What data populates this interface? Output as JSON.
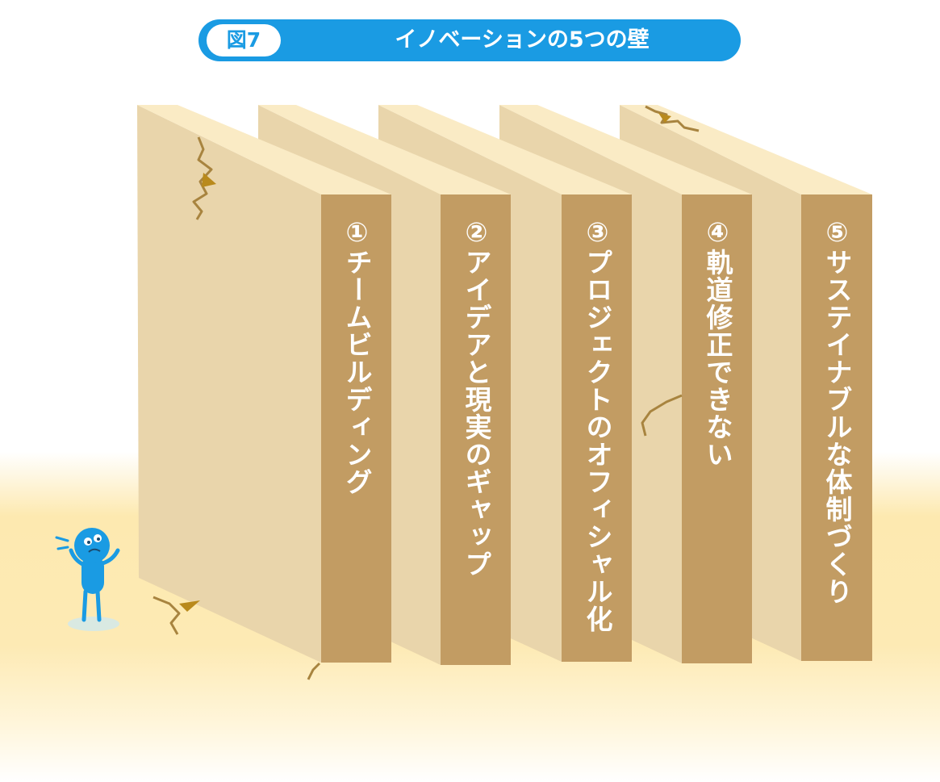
{
  "title": {
    "badge": "図7",
    "text": "イノベーションの5つの壁"
  },
  "walls": [
    {
      "label": "①チームビルディング"
    },
    {
      "label": "②アイデアと現実のギャップ"
    },
    {
      "label": "③プロジェクトのオフィシャル化"
    },
    {
      "label": "④軌道修正できない"
    },
    {
      "label": "⑤サステイナブルな体制づくり"
    }
  ],
  "colors": {
    "title_bar": "#1a9be3",
    "wall_side": "#c29c63",
    "wall_face": "#e9d5ab",
    "wall_top": "#faebc5",
    "ground": "#fde9b0",
    "character": "#1a9be3"
  },
  "icons": [
    "worried-character-icon",
    "crack-icon"
  ]
}
